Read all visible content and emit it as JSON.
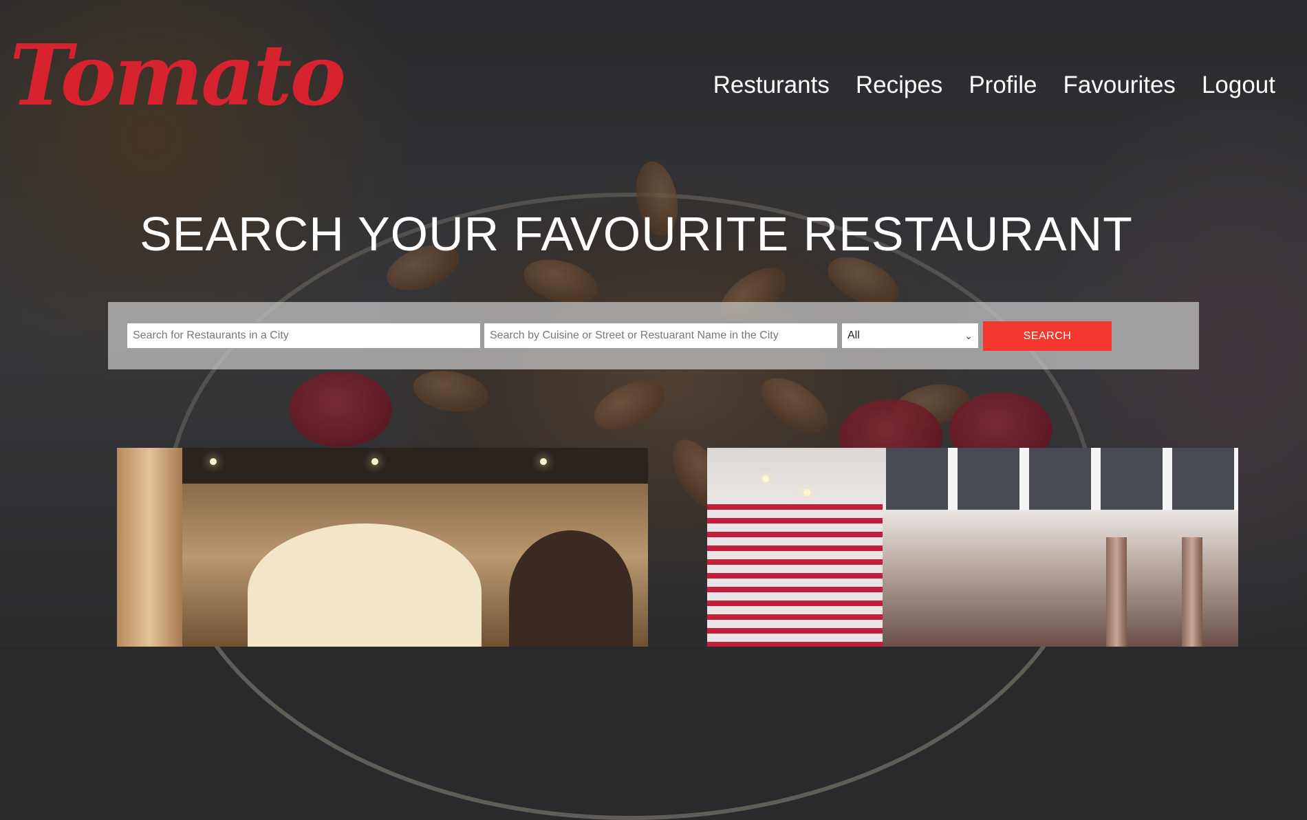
{
  "brand": {
    "logo_text": "Tomato",
    "color": "#d6232f"
  },
  "nav": {
    "items": [
      {
        "label": "Resturants"
      },
      {
        "label": "Recipes"
      },
      {
        "label": "Profile"
      },
      {
        "label": "Favourites"
      },
      {
        "label": "Logout"
      }
    ]
  },
  "hero": {
    "headline": "SEARCH YOUR FAVOURITE RESTAURANT"
  },
  "search": {
    "city_placeholder": "Search for Restaurants in a City",
    "query_placeholder": "Search by Cuisine or Street or Restuarant Name in the City",
    "category_selected": "All",
    "button_label": "SEARCH",
    "button_color": "#f2382f"
  },
  "icons": {
    "select_caret": "chevron-down-icon"
  }
}
